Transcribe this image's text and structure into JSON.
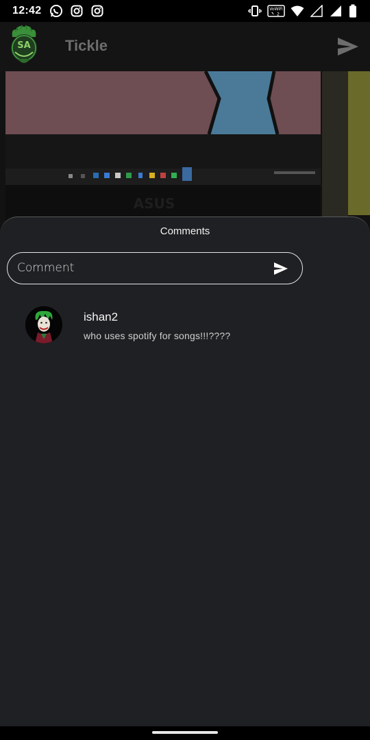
{
  "status_bar": {
    "time": "12:42",
    "left_icons": [
      "whatsapp-icon",
      "instagram-icon",
      "instagram-icon"
    ],
    "right_icons": [
      "vibrate-icon",
      "vowifi-icon",
      "wifi-icon",
      "signal-icon",
      "signal-icon",
      "battery-icon"
    ],
    "vowifi_label": "VoWiFi",
    "vowifi_sim": "2"
  },
  "app_bar": {
    "title": "Tickle",
    "logo_text": "SA"
  },
  "post_image": {
    "brand_text": "ASUS"
  },
  "comments_sheet": {
    "title": "Comments",
    "input": {
      "placeholder": "Comment",
      "value": ""
    },
    "comments": [
      {
        "username": "ishan2",
        "text": "who uses spotify for songs!!!????"
      }
    ]
  },
  "colors": {
    "sheet_bg": "#1f2023",
    "app_bar_bg": "#141414",
    "title_color": "#6d6d6d",
    "accent_green": "#3bb34a"
  }
}
